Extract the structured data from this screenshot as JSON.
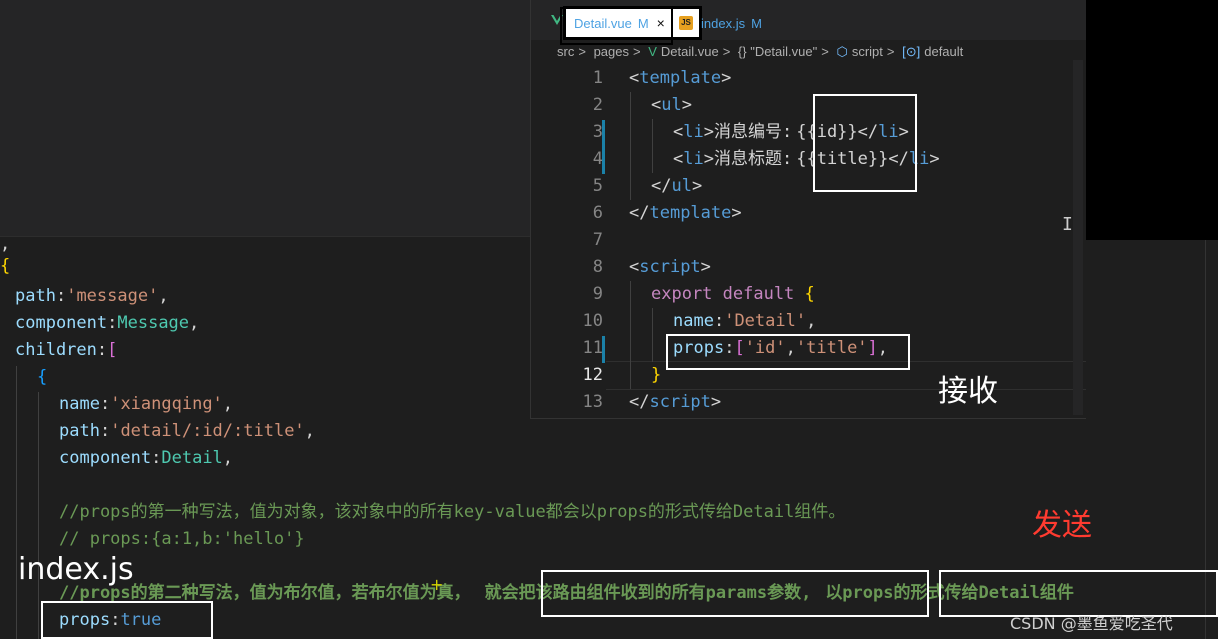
{
  "tabs": [
    {
      "label": "Detail.vue",
      "modified": "M",
      "close": "×",
      "active": true
    },
    {
      "label": "index.js",
      "modified": "M",
      "icon": "JS"
    }
  ],
  "breadcrumb": [
    "src",
    ">",
    "pages",
    ">",
    "Detail.vue",
    ">",
    "{} \"Detail.vue\"",
    ">",
    "script",
    ">",
    "default"
  ],
  "detail_code": {
    "line_numbers": [
      "1",
      "2",
      "3",
      "4",
      "5",
      "6",
      "7",
      "8",
      "9",
      "10",
      "11",
      "12",
      "13"
    ],
    "lines": {
      "l1": {
        "open": "<",
        "tag": "template",
        "close": ">"
      },
      "l2": {
        "open": "<",
        "tag": "ul",
        "close": ">"
      },
      "l3": {
        "open": "<",
        "tag": "li",
        "close": ">",
        "text": "消息编号:",
        "expr": "{{id}}",
        "endtag": "</",
        "endtag_name": "li",
        "endclose": ">"
      },
      "l4": {
        "open": "<",
        "tag": "li",
        "close": ">",
        "text": "消息标题:",
        "expr": "{{title}}",
        "endtag": "</",
        "endtag_name": "li",
        "endclose": ">"
      },
      "l5": {
        "open": "</",
        "tag": "ul",
        "close": ">"
      },
      "l6": {
        "open": "</",
        "tag": "template",
        "close": ">"
      },
      "l8": {
        "open": "<",
        "tag": "script",
        "close": ">"
      },
      "l9": {
        "kw": "export default",
        "brace": "{"
      },
      "l10": {
        "key": "name",
        "colon": ":",
        "val": "'Detail'",
        "comma": ","
      },
      "l11": {
        "key": "props",
        "colon": ":",
        "lb": "[",
        "v1": "'id'",
        "sep": ",",
        "v2": "'title'",
        "rb": "]",
        "comma": ","
      },
      "l12": {
        "brace": "}"
      },
      "l13": {
        "open": "</",
        "tag": "script",
        "close": ">"
      }
    }
  },
  "index_code": {
    "l0": ",",
    "l0b": "{",
    "path_key": "path",
    "path_val": "'message'",
    "component_key": "component",
    "component_val": "Message",
    "children_key": "children",
    "children_lb": "[",
    "open_brace": "{",
    "name_key": "name",
    "name_val": "'xiangqing'",
    "path2_key": "path",
    "path2_val": "'detail/:id/:title'",
    "component2_key": "component",
    "component2_val": "Detail",
    "comment1": "//props的第一种写法，值为对象，该对象中的所有key-value都会以props的形式传给Detail组件。",
    "comment2": "// props:{a:1,b:'hello'}",
    "comment3_a": "//props的第二种写法，值为布尔值，若布尔值为真，",
    "comment3_b": "就会把该路由组件收到的所有params参数,",
    "comment3_c": "以props的形式传给Detail组件",
    "props_key": "props",
    "props_val": "true",
    "colon": ":",
    "comma": ","
  },
  "annotations": {
    "receive": "接收",
    "send": "发送",
    "indexjs": "index.js",
    "watermark": "CSDN @墨鱼爱吃圣代"
  },
  "colors": {
    "send": "#ff3b30",
    "tab_text": "#4fa3e3",
    "js_icon": "#e6a020"
  }
}
